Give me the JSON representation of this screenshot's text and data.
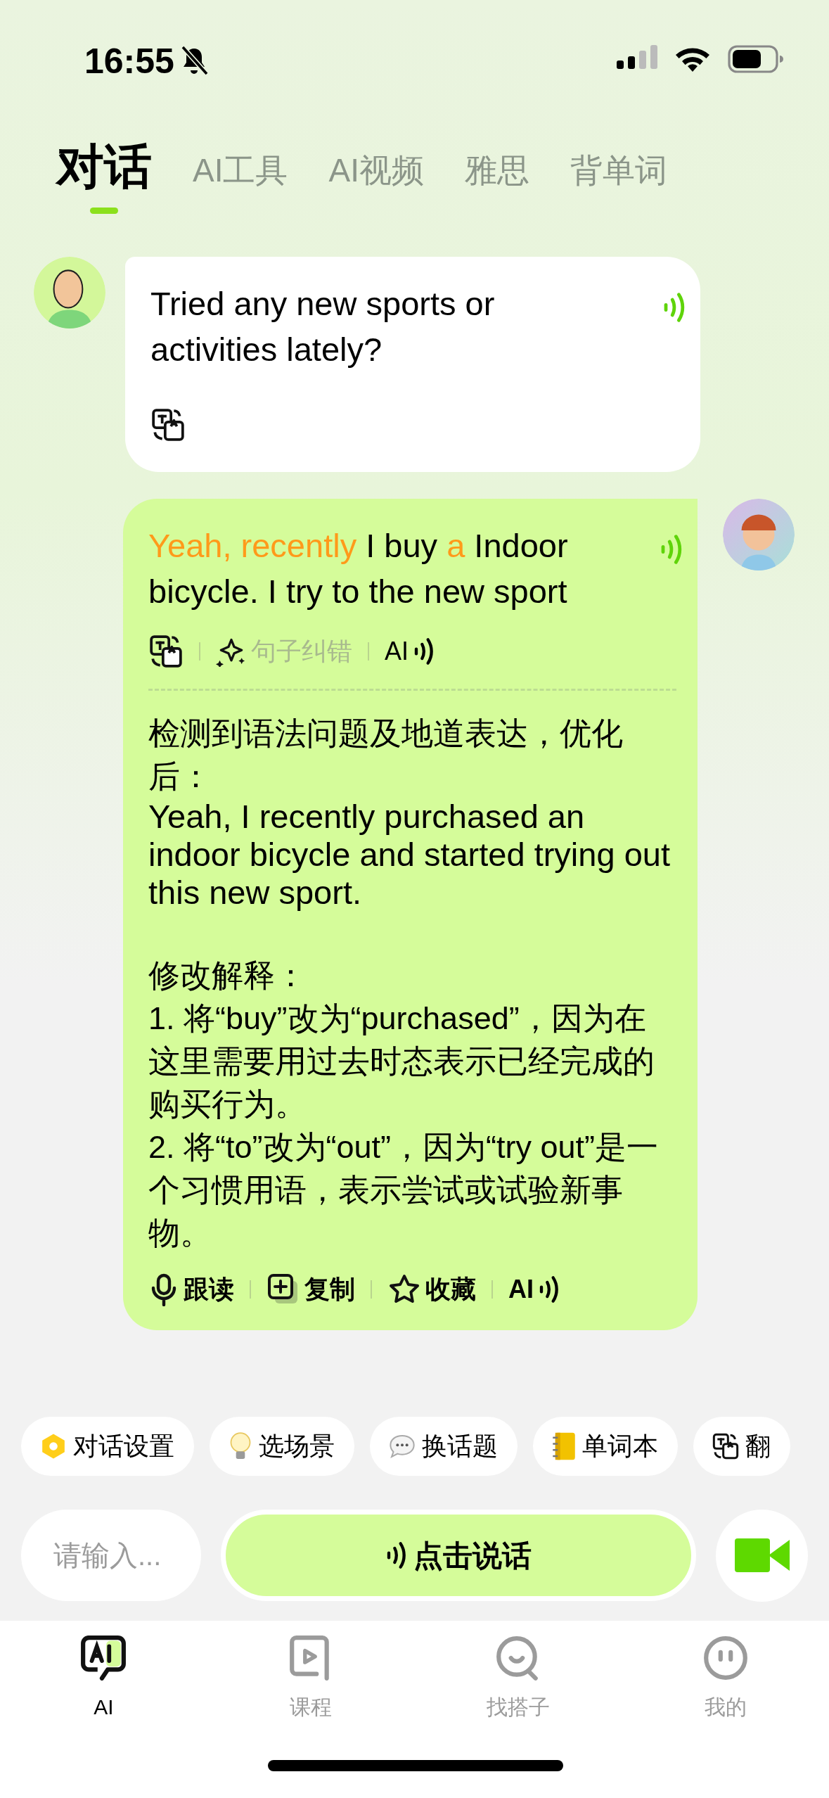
{
  "status_bar": {
    "time": "16:55"
  },
  "tabs": [
    {
      "label": "对话",
      "selected": true
    },
    {
      "label": "AI工具",
      "selected": false
    },
    {
      "label": "AI视频",
      "selected": false
    },
    {
      "label": "雅思",
      "selected": false
    },
    {
      "label": "背单词",
      "selected": false
    }
  ],
  "messages": [
    {
      "kind": "bot",
      "text": "Tried any new sports or activities lately?",
      "actions": [
        {
          "kind": "translate"
        }
      ]
    },
    {
      "kind": "user",
      "segments": [
        {
          "text": "Yeah, recently",
          "highlighted": true
        },
        {
          "text": " I buy ",
          "highlighted": false
        },
        {
          "text": "a",
          "highlighted": true
        },
        {
          "text": " Indoor bicycle. I try to the new sport",
          "highlighted": false
        }
      ],
      "actions": [
        {
          "kind": "translate"
        },
        {
          "kind": "correct",
          "label": "句子纠错",
          "disabled": true
        },
        {
          "kind": "ai_voice",
          "label": "AI"
        }
      ],
      "correction": {
        "header": "检测到语法问题及地道表达，优化后：",
        "corrected": "Yeah, I recently purchased an indoor bicycle and started trying out this new sport.",
        "explanation_title": "修改解释：",
        "explanation_items": [
          "1. 将“buy”改为“purchased”，因为在这里需要用过去时态表示已经完成的购买行为。",
          "2. 将“to”改为“out”，因为“try out”是一个习惯用语，表示尝试或试验新事物。"
        ]
      },
      "footer_actions": [
        {
          "kind": "follow",
          "label": "跟读"
        },
        {
          "kind": "copy",
          "label": "复制"
        },
        {
          "kind": "favorite",
          "label": "收藏"
        },
        {
          "kind": "ai_voice",
          "label": "AI"
        }
      ]
    }
  ],
  "chips": [
    {
      "kind": "settings",
      "label": "对话设置"
    },
    {
      "kind": "scene",
      "label": "选场景"
    },
    {
      "kind": "topic",
      "label": "换话题"
    },
    {
      "kind": "wordbook",
      "label": "单词本"
    },
    {
      "kind": "translate",
      "label": "翻"
    }
  ],
  "input": {
    "placeholder": "请输入..."
  },
  "voice_button": {
    "label": "点击说话"
  },
  "bottom_nav": [
    {
      "kind": "ai",
      "label": "AI",
      "selected": true
    },
    {
      "kind": "course",
      "label": "课程",
      "selected": false
    },
    {
      "kind": "partner",
      "label": "找搭子",
      "selected": false
    },
    {
      "kind": "me",
      "label": "我的",
      "selected": false
    }
  ]
}
